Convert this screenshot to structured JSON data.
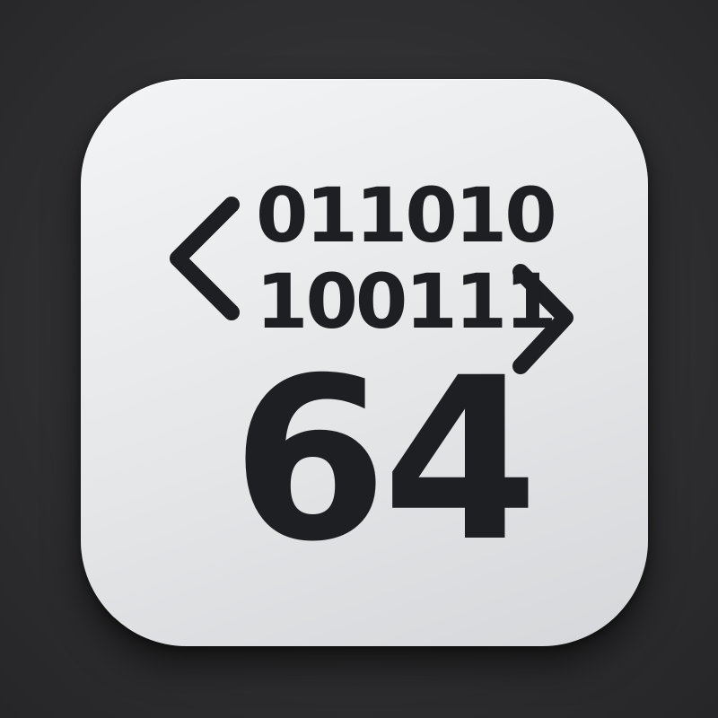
{
  "icon": {
    "binary_line_1": "011010",
    "binary_line_2": "100111",
    "number": "64",
    "left_glyph": "chevron-left-icon",
    "right_glyph": "chevron-right-icon"
  },
  "colors": {
    "background": "#2e2e30",
    "tile": "#e6e8ea",
    "ink": "#1d1f22"
  }
}
